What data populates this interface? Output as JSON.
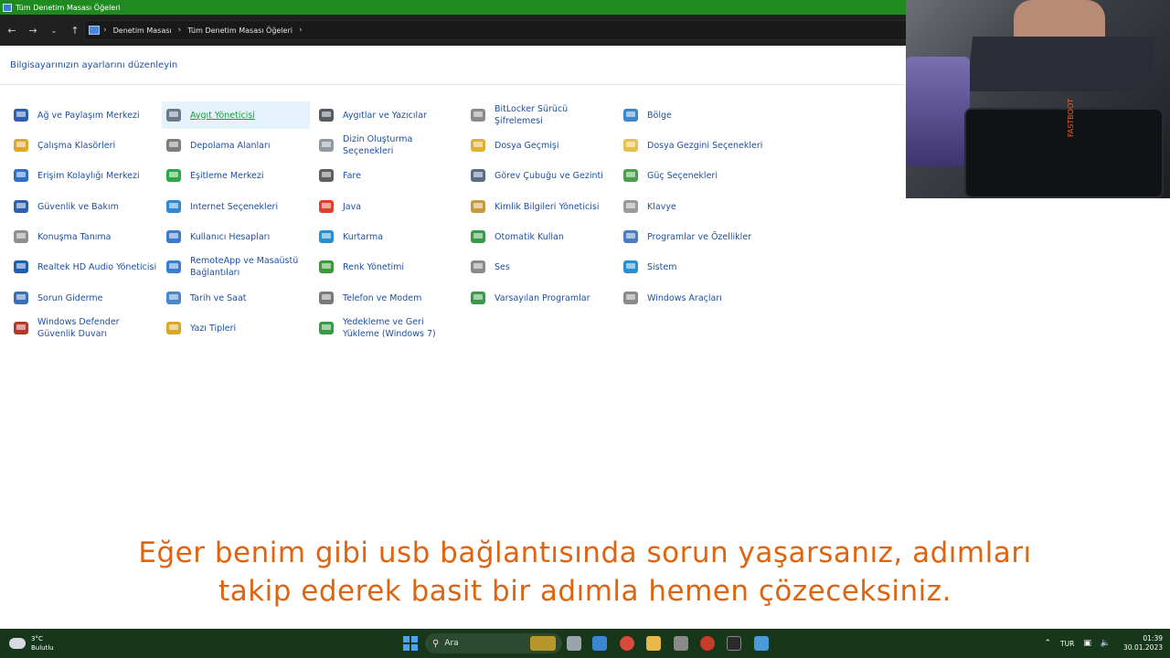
{
  "window": {
    "title": "Tüm Denetim Masası Öğeleri"
  },
  "breadcrumb": [
    "Denetim Masası",
    "Tüm Denetim Masası Öğeleri"
  ],
  "heading": "Bilgisayarınızın ayarlarını düzenleyin",
  "items": [
    {
      "label": "Ağ ve Paylaşım Merkezi",
      "icon": "network-icon",
      "color": "#2d5fb5"
    },
    {
      "label": "Aygıt Yöneticisi",
      "icon": "device-manager-icon",
      "color": "#6b7a8a",
      "hovered": true
    },
    {
      "label": "Aygıtlar ve Yazıcılar",
      "icon": "printer-icon",
      "color": "#555b63"
    },
    {
      "label": "BitLocker Sürücü Şifrelemesi",
      "icon": "bitlocker-icon",
      "color": "#8a8a8a"
    },
    {
      "label": "Bölge",
      "icon": "globe-clock-icon",
      "color": "#3a86d1"
    },
    {
      "label": "Çalışma Klasörleri",
      "icon": "work-folders-icon",
      "color": "#e0a82a"
    },
    {
      "label": "Depolama Alanları",
      "icon": "storage-icon",
      "color": "#7d7d7d"
    },
    {
      "label": "Dizin Oluşturma Seçenekleri",
      "icon": "indexing-icon",
      "color": "#8f98a3"
    },
    {
      "label": "Dosya Geçmişi",
      "icon": "file-history-icon",
      "color": "#e0b030"
    },
    {
      "label": "Dosya Gezgini Seçenekleri",
      "icon": "folder-options-icon",
      "color": "#e6c04a"
    },
    {
      "label": "Erişim Kolaylığı Merkezi",
      "icon": "accessibility-icon",
      "color": "#2f6fc9"
    },
    {
      "label": "Eşitleme Merkezi",
      "icon": "sync-icon",
      "color": "#2fa84a"
    },
    {
      "label": "Fare",
      "icon": "mouse-icon",
      "color": "#606060"
    },
    {
      "label": "Görev Çubuğu ve Gezinti",
      "icon": "taskbar-icon",
      "color": "#5a6d86"
    },
    {
      "label": "Güç Seçenekleri",
      "icon": "power-icon",
      "color": "#4aa04a"
    },
    {
      "label": "Güvenlik ve Bakım",
      "icon": "flag-icon",
      "color": "#2f5fb0"
    },
    {
      "label": "Internet Seçenekleri",
      "icon": "internet-options-icon",
      "color": "#2f8ad6"
    },
    {
      "label": "Java",
      "icon": "java-icon",
      "color": "#d8442a"
    },
    {
      "label": "Kimlik Bilgileri Yöneticisi",
      "icon": "credential-icon",
      "color": "#c99a3a"
    },
    {
      "label": "Klavye",
      "icon": "keyboard-icon",
      "color": "#9a9a9a"
    },
    {
      "label": "Konuşma Tanıma",
      "icon": "microphone-icon",
      "color": "#8f8f8f"
    },
    {
      "label": "Kullanıcı Hesapları",
      "icon": "users-icon",
      "color": "#3f7ac8"
    },
    {
      "label": "Kurtarma",
      "icon": "recovery-icon",
      "color": "#2a8fcf"
    },
    {
      "label": "Otomatik Kullan",
      "icon": "autoplay-icon",
      "color": "#3a9a4a"
    },
    {
      "label": "Programlar ve Özellikler",
      "icon": "programs-icon",
      "color": "#4a7dc0"
    },
    {
      "label": "Realtek HD Audio Yöneticisi",
      "icon": "realtek-icon",
      "color": "#1f5fb0"
    },
    {
      "label": "RemoteApp ve Masaüstü Bağlantıları",
      "icon": "remoteapp-icon",
      "color": "#3a7ed0"
    },
    {
      "label": "Renk Yönetimi",
      "icon": "color-management-icon",
      "color": "#3a9a3a"
    },
    {
      "label": "Ses",
      "icon": "speaker-icon",
      "color": "#8a8a8a"
    },
    {
      "label": "Sistem",
      "icon": "system-icon",
      "color": "#2a8fcf"
    },
    {
      "label": "Sorun Giderme",
      "icon": "troubleshoot-icon",
      "color": "#3a6fb8"
    },
    {
      "label": "Tarih ve Saat",
      "icon": "datetime-icon",
      "color": "#4a86c9"
    },
    {
      "label": "Telefon ve Modem",
      "icon": "phone-modem-icon",
      "color": "#7a7a7a"
    },
    {
      "label": "Varsayılan Programlar",
      "icon": "default-programs-icon",
      "color": "#3a9a4a"
    },
    {
      "label": "Windows Araçları",
      "icon": "tools-icon",
      "color": "#8a8a8a"
    },
    {
      "label": "Windows Defender Güvenlik Duvarı",
      "icon": "firewall-icon",
      "color": "#b03a2a"
    },
    {
      "label": "Yazı Tipleri",
      "icon": "fonts-icon",
      "color": "#d8a82a"
    },
    {
      "label": "Yedekleme ve Geri Yükleme (Windows 7)",
      "icon": "backup-icon",
      "color": "#3a9a4a"
    }
  ],
  "webcam": {
    "phone_text": "FASTBOOT"
  },
  "subtitle": {
    "line1": "Eğer benim gibi usb bağlantısında sorun yaşarsanız, adımları",
    "line2": "takip ederek basit bir adımla hemen çözeceksiniz."
  },
  "taskbar": {
    "weather_temp": "3°C",
    "weather_desc": "Bulutlu",
    "search_placeholder": "Ara",
    "language": "TUR",
    "time": "01:39",
    "date": "30.01.2023"
  },
  "colors": {
    "accent": "#1f8a1f",
    "link": "#1d4e9e",
    "subtitle": "#e0640f",
    "taskbar": "#16371a"
  }
}
